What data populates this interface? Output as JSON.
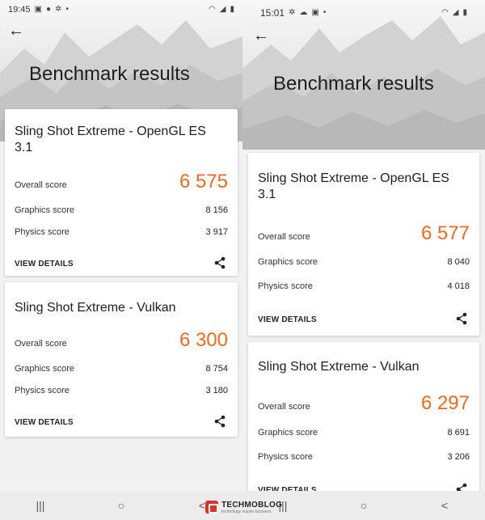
{
  "left": {
    "status": {
      "time": "19:45"
    },
    "back_icon": "arrow-left-icon",
    "title": "Benchmark results",
    "cards": [
      {
        "title": "Sling Shot Extreme - OpenGL ES 3.1",
        "overall_label": "Overall score",
        "overall_value": "6 575",
        "graphics_label": "Graphics score",
        "graphics_value": "8 156",
        "physics_label": "Physics score",
        "physics_value": "3 917",
        "details_label": "VIEW DETAILS"
      },
      {
        "title": "Sling Shot Extreme - Vulkan",
        "overall_label": "Overall score",
        "overall_value": "6 300",
        "graphics_label": "Graphics score",
        "graphics_value": "8 754",
        "physics_label": "Physics score",
        "physics_value": "3 180",
        "details_label": "VIEW DETAILS"
      }
    ]
  },
  "right": {
    "status": {
      "time": "15:01"
    },
    "back_icon": "arrow-left-icon",
    "title": "Benchmark results",
    "cards": [
      {
        "title": "Sling Shot Extreme - OpenGL ES 3.1",
        "overall_label": "Overall score",
        "overall_value": "6 577",
        "graphics_label": "Graphics score",
        "graphics_value": "8 040",
        "physics_label": "Physics score",
        "physics_value": "4 018",
        "details_label": "VIEW DETAILS"
      },
      {
        "title": "Sling Shot Extreme - Vulkan",
        "overall_label": "Overall score",
        "overall_value": "6 297",
        "graphics_label": "Graphics score",
        "graphics_value": "8 691",
        "physics_label": "Physics score",
        "physics_value": "3 206",
        "details_label": "VIEW DETAILS"
      }
    ]
  },
  "navbar": {
    "recents_icon": "|||",
    "home_icon": "○",
    "back_icon": "<"
  },
  "watermark": {
    "name": "TECHMOBLOG",
    "tagline": "technology inspire business"
  },
  "colors": {
    "accent": "#f06a1e",
    "card": "#ffffff",
    "background": "#f1f1f1"
  }
}
